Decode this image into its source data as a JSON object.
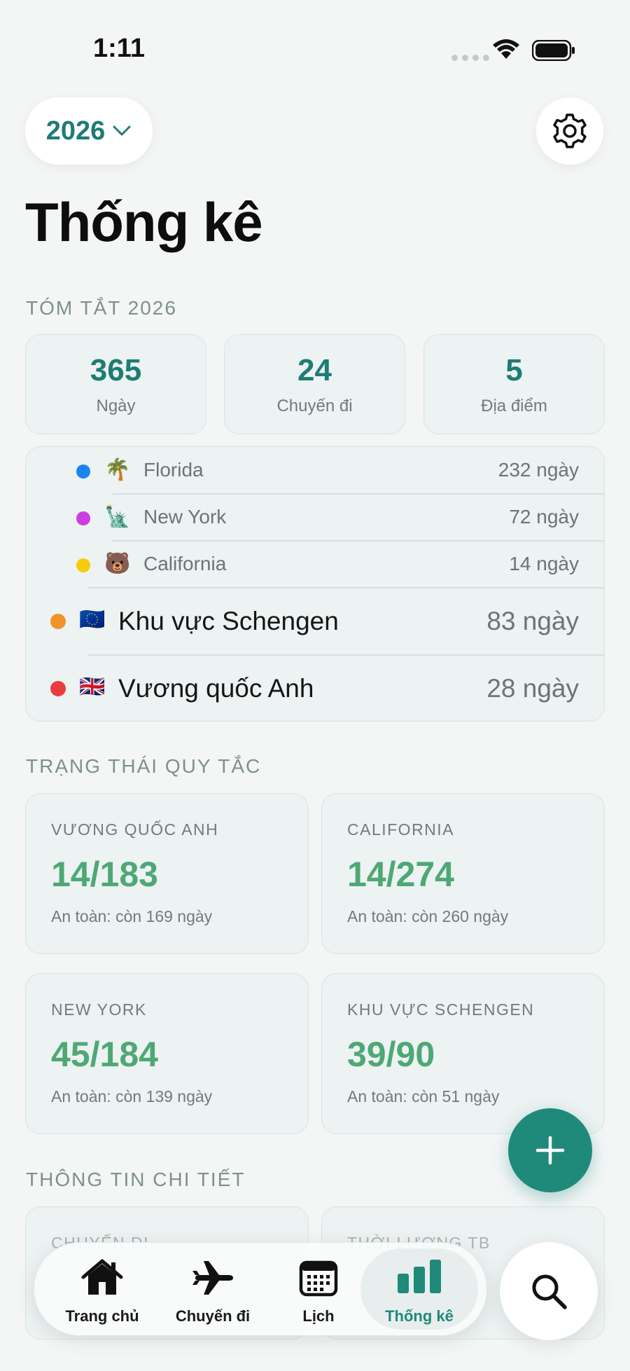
{
  "status_bar": {
    "time": "1:11"
  },
  "header": {
    "year": "2026",
    "title": "Thống kê"
  },
  "summary": {
    "section_label": "TÓM TẮT 2026",
    "cards": [
      {
        "value": "365",
        "label": "Ngày"
      },
      {
        "value": "24",
        "label": "Chuyến đi"
      },
      {
        "value": "5",
        "label": "Địa điểm"
      }
    ]
  },
  "locations": [
    {
      "emoji": "🌴",
      "name": "Florida",
      "days": "232 ngày",
      "color": "#1a85f0"
    },
    {
      "emoji": "🗽",
      "name": "New York",
      "days": "72 ngày",
      "color": "#cc3ee0"
    },
    {
      "emoji": "🐻",
      "name": "California",
      "days": "14 ngày",
      "color": "#f5cc0a"
    },
    {
      "emoji": "🇪🇺",
      "name": "Khu vực Schengen",
      "days": "83 ngày",
      "color": "#f2922b"
    },
    {
      "emoji": "🇬🇧",
      "name": "Vương quốc Anh",
      "days": "28 ngày",
      "color": "#ea3c3f"
    }
  ],
  "rules": {
    "section_label": "TRẠNG THÁI QUY TẮC",
    "cards": [
      {
        "label": "VƯƠNG QUỐC ANH",
        "value": "14/183",
        "note": "An toàn: còn 169 ngày"
      },
      {
        "label": "CALIFORNIA",
        "value": "14/274",
        "note": "An toàn: còn 260 ngày"
      },
      {
        "label": "NEW YORK",
        "value": "45/184",
        "note": "An toàn: còn 139 ngày"
      },
      {
        "label": "KHU VỰC SCHENGEN",
        "value": "39/90",
        "note": "An toàn: còn 51 ngày"
      }
    ]
  },
  "details": {
    "section_label": "THÔNG TIN CHI TIẾT",
    "cards": [
      {
        "label": "CHUYẾN ĐI"
      },
      {
        "label": "THỜI LƯỢNG TB"
      }
    ]
  },
  "tabbar": {
    "tabs": [
      {
        "label": "Trang chủ",
        "icon": "house-icon"
      },
      {
        "label": "Chuyến đi",
        "icon": "airplane-icon"
      },
      {
        "label": "Lịch",
        "icon": "calendar-icon"
      },
      {
        "label": "Thống kê",
        "icon": "chart-bar-icon",
        "active": true
      }
    ]
  },
  "accent_color": "#1f8a7a",
  "safe_color": "#4ea875"
}
